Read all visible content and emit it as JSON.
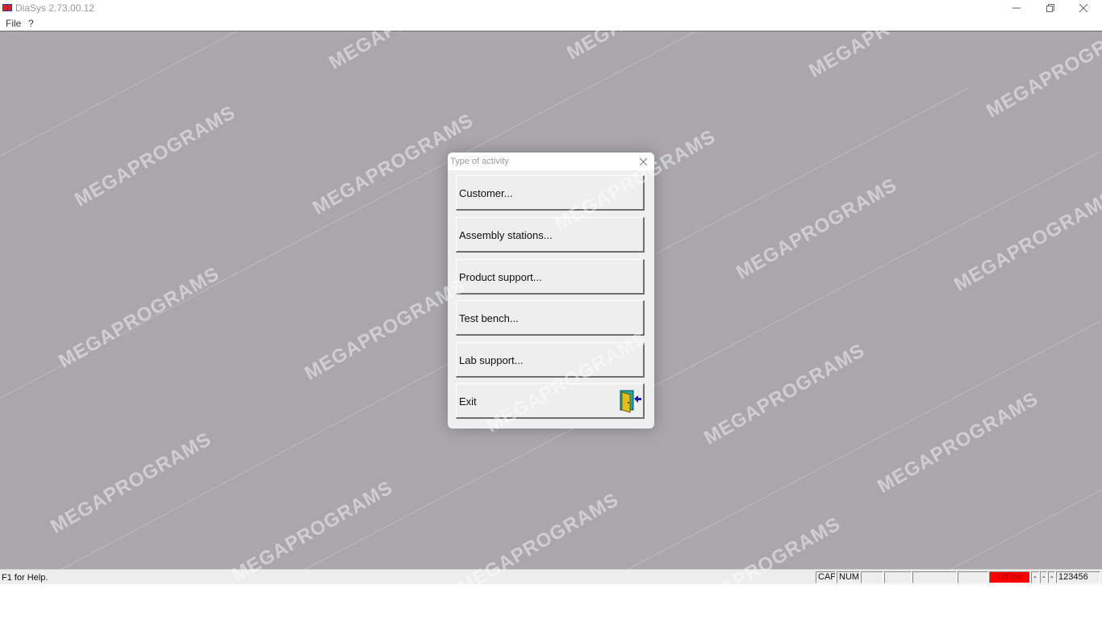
{
  "window": {
    "title": "DiaSys 2.73.00.12"
  },
  "menu": {
    "items": [
      "File",
      "?"
    ]
  },
  "dialog": {
    "title": "Type of activity",
    "buttons": [
      {
        "label": "Customer..."
      },
      {
        "label": "Assembly stations..."
      },
      {
        "label": "Product support..."
      },
      {
        "label": "Test bench..."
      },
      {
        "label": "Lab support..."
      },
      {
        "label": "Exit",
        "icon": "exit-door-icon"
      }
    ]
  },
  "statusbar": {
    "help": "F1 for Help.",
    "panes": [
      "CAP",
      "NUM",
      "",
      "",
      "",
      "",
      "Offline",
      "-",
      "-",
      "-",
      "123456"
    ]
  },
  "watermark": {
    "text": "MEGAPROGRAMS"
  },
  "colors": {
    "workspace": "#a9a7aa",
    "offline": "#ff0000"
  }
}
